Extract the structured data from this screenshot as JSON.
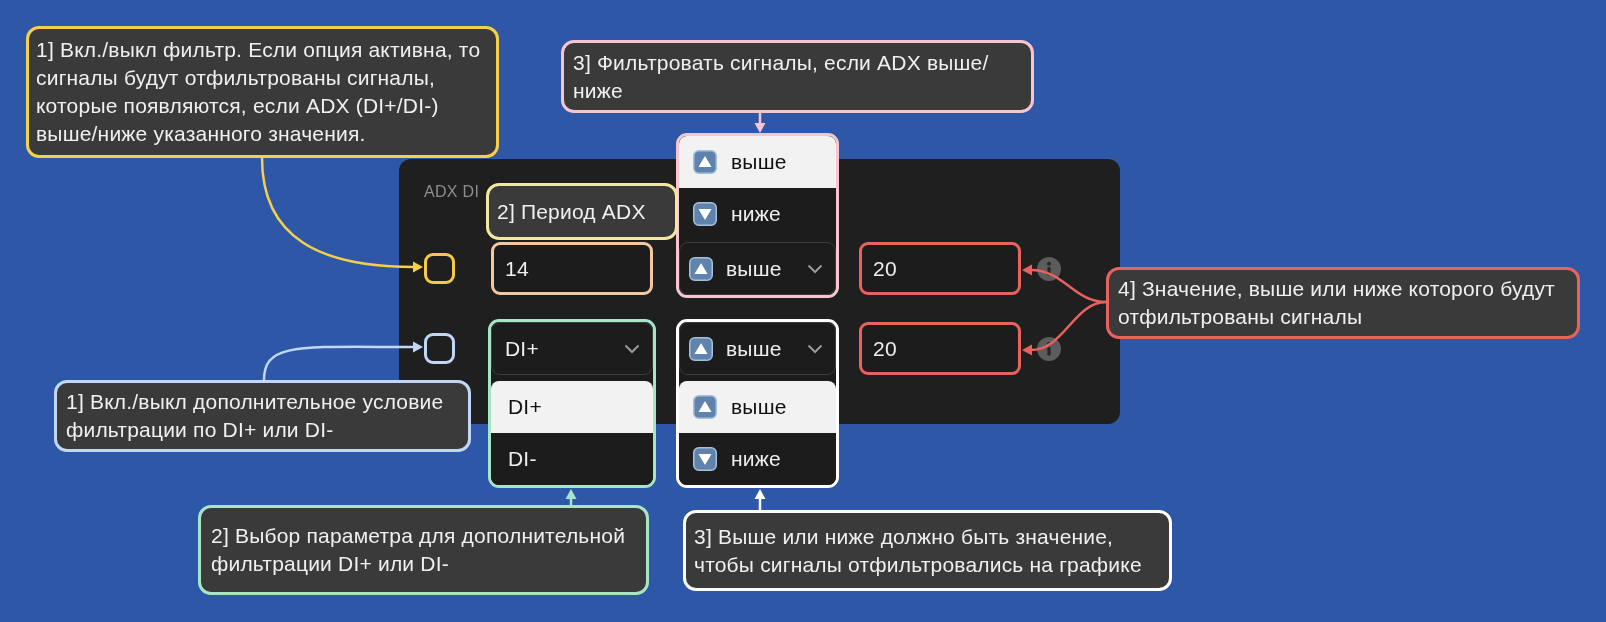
{
  "panel": {
    "title": "ADX DI",
    "rows": [
      {
        "checkbox": {
          "checked": false,
          "color": "#f5ca45"
        },
        "param": {
          "kind": "input",
          "value": "14",
          "color": "#f2c8a2"
        },
        "direction": {
          "kind": "select",
          "value": "выше",
          "expanded": true,
          "color": "#f6c5d0",
          "options": [
            {
              "kind": "up",
              "label": "выше",
              "selected": true
            },
            {
              "kind": "down",
              "label": "ниже",
              "selected": false
            }
          ]
        },
        "threshold": {
          "value": "20",
          "color": "#e8625f"
        }
      },
      {
        "checkbox": {
          "checked": false,
          "color": "#c2d7f5"
        },
        "param": {
          "kind": "select",
          "value": "DI+",
          "expanded": true,
          "color": "#a6e6c6",
          "options": [
            {
              "label": "DI+",
              "selected": true
            },
            {
              "label": "DI-",
              "selected": false
            }
          ]
        },
        "direction": {
          "kind": "select",
          "value": "выше",
          "expanded": true,
          "color": "#ffffff",
          "options": [
            {
              "kind": "up",
              "label": "выше",
              "selected": true
            },
            {
              "kind": "down",
              "label": "ниже",
              "selected": false
            }
          ]
        },
        "threshold": {
          "value": "20",
          "color": "#e8625f"
        }
      }
    ]
  },
  "callouts": [
    {
      "text": "1] Вкл./выкл фильтр. Если опция активна, то сигналы будут отфильтрованы сигналы, которые появляются, если ADX (DI+/DI-) выше/ниже указанного значения.",
      "color": "#f5d04c"
    },
    {
      "text": "3] Фильтровать сигналы, если ADX выше/ниже",
      "color": "#f6c5d0"
    },
    {
      "text": "2] Период ADX",
      "color": "#f3e7a3"
    },
    {
      "text": "4] Значение, выше или ниже которого будут отфильтрованы сигналы",
      "color": "#e8625f"
    },
    {
      "text": "1] Вкл./выкл дополнительное условие фильтрации по DI+ или DI-",
      "color": "#c2d7f5"
    },
    {
      "text": "2] Выбор параметра для дополнительной фильтрации DI+ или DI-",
      "color": "#a6e6c6"
    },
    {
      "text": "3] Выше или ниже должно быть значение, чтобы сигналы отфильтровались на графике",
      "color": "#ffffff"
    }
  ]
}
